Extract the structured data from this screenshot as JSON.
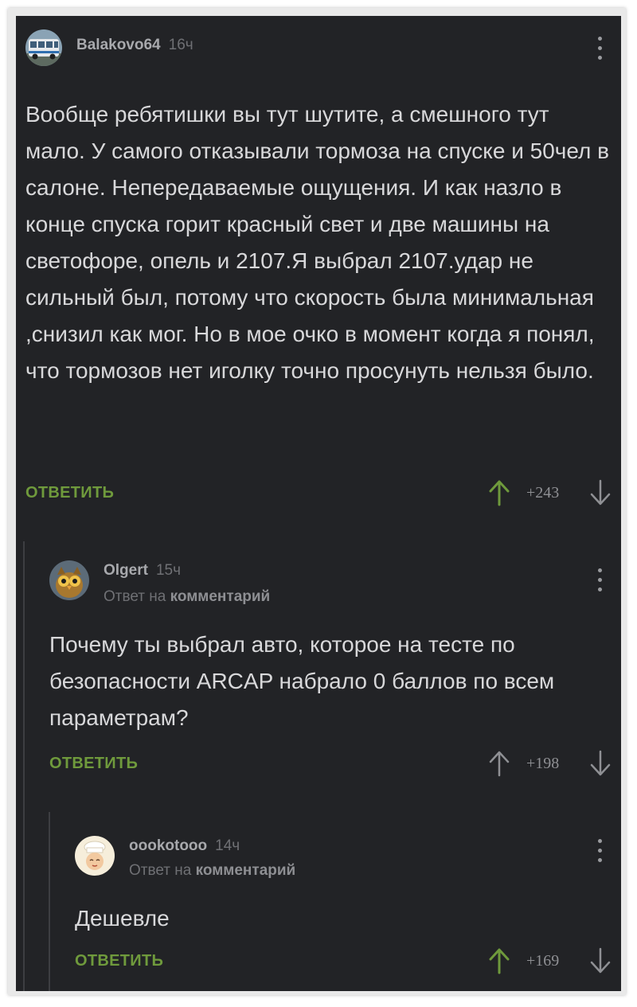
{
  "comments": [
    {
      "username": "Balakovo64",
      "time": "16ч",
      "body": "Вообще ребятишки вы тут шутите, а смешного тут мало. У самого отказывали тормоза на спуске и 50чел в салоне. Непередаваемые ощущения. И как назло в конце спуска горит красный свет и две машины на светофоре, опель и 2107.Я выбрал 2107.удар не сильный был, потому что скорость была минимальная ,снизил как мог. Но в мое очко в момент когда я понял, что тормозов нет иголку точно просунуть нельзя было.",
      "reply_label": "ОТВЕТИТЬ",
      "score": "+243"
    },
    {
      "username": "Olgert",
      "time": "15ч",
      "reply_prefix": "Ответ на",
      "reply_link": "комментарий",
      "body": "Почему ты выбрал авто, которое на тесте по безопасности ARCAP набрало 0 баллов по всем параметрам?",
      "reply_label": "ОТВЕТИТЬ",
      "score": "+198"
    },
    {
      "username": "oookotooo",
      "time": "14ч",
      "reply_prefix": "Ответ на",
      "reply_link": "комментарий",
      "body": "Дешевле",
      "reply_label": "ОТВЕТИТЬ",
      "score": "+169"
    }
  ],
  "colors": {
    "background": "#222326",
    "text": "#d8d8da",
    "accent_green": "#6f9a3c",
    "muted": "#6f7074"
  },
  "icons": {
    "upvote_active": "arrow-up-icon (green)",
    "upvote_neutral": "arrow-up-icon (gray)",
    "downvote": "arrow-down-icon",
    "menu": "kebab-menu-icon"
  }
}
